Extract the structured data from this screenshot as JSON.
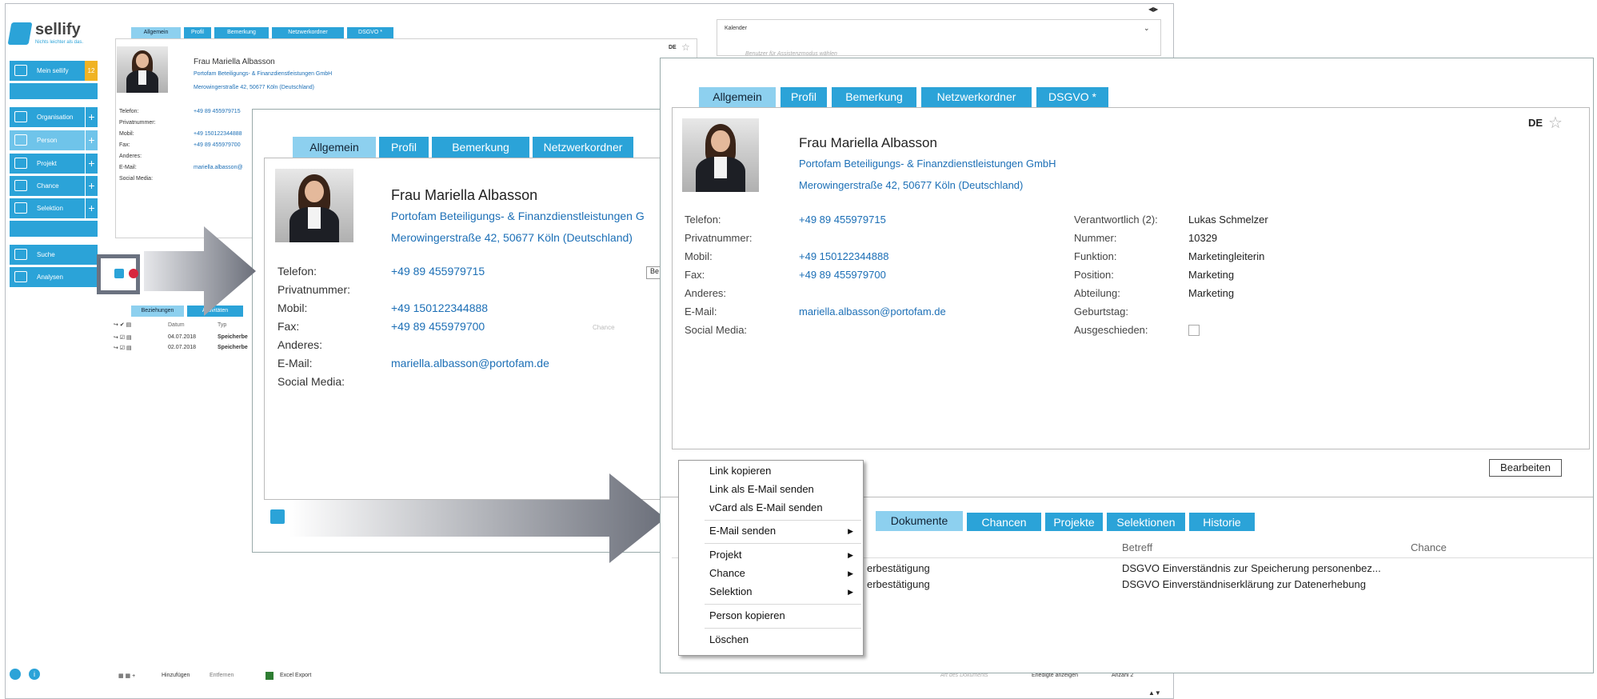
{
  "app": {
    "logo_name": "sellify",
    "logo_tagline": "Nichts leichter als das.",
    "window_controls": "◀▶"
  },
  "sidebar": {
    "items": [
      {
        "label": "Mein sellify",
        "badge": "12"
      },
      {
        "label": "Organisation"
      },
      {
        "label": "Person"
      },
      {
        "label": "Projekt"
      },
      {
        "label": "Chance"
      },
      {
        "label": "Selektion"
      },
      {
        "label": "Suche"
      },
      {
        "label": "Analysen"
      }
    ]
  },
  "base": {
    "tabs": [
      "Allgemein",
      "Profil",
      "Bemerkung",
      "Netzwerkordner",
      "DSGVO *"
    ],
    "lang": "DE",
    "name": "Frau Mariella Albasson",
    "company": "Portofam Beteiligungs- & Finanzdienstleistungen GmbH",
    "address": "Merowingerstraße 42, 50677 Köln (Deutschland)",
    "fields": [
      {
        "label": "Telefon:",
        "value": "+49 89 455979715"
      },
      {
        "label": "Privatnummer:",
        "value": ""
      },
      {
        "label": "Mobil:",
        "value": "+49 150122344888"
      },
      {
        "label": "Fax:",
        "value": "+49 89 455979700"
      },
      {
        "label": "Anderes:",
        "value": ""
      },
      {
        "label": "E-Mail:",
        "value": "mariella.albasson@"
      },
      {
        "label": "Social Media:",
        "value": ""
      }
    ],
    "calendar_title": "Kalender",
    "calendar_placeholder": "Benutzer für Assistenzmodus wählen",
    "lower_tabs": [
      "Beziehungen",
      "Aktivitäten"
    ],
    "table_headers": [
      "Datum",
      "Typ"
    ],
    "rows": [
      {
        "date": "04.07.2018",
        "type": "Speicherbe"
      },
      {
        "date": "02.07.2018",
        "type": "Speicherbe"
      }
    ],
    "footer": {
      "add": "Hinzufügen",
      "remove": "Entfernen",
      "export": "Excel Export",
      "doc_type": "Art des Dokuments",
      "show_done": "Erledigte anzeigen",
      "count": "Anzahl 2"
    }
  },
  "mid": {
    "tabs": [
      "Allgemein",
      "Profil",
      "Bemerkung",
      "Netzwerkordner"
    ],
    "name": "Frau Mariella Albasson",
    "company": "Portofam Beteiligungs- & Finanzdienstleistungen G",
    "address": "Merowingerstraße 42, 50677 Köln (Deutschland)",
    "fields": [
      {
        "label": "Telefon:",
        "value": "+49 89 455979715"
      },
      {
        "label": "Privatnummer:",
        "value": ""
      },
      {
        "label": "Mobil:",
        "value": "+49 150122344888"
      },
      {
        "label": "Fax:",
        "value": "+49 89 455979700"
      },
      {
        "label": "Anderes:",
        "value": ""
      },
      {
        "label": "E-Mail:",
        "value": "mariella.albasson@portofam.de"
      },
      {
        "label": "Social Media:",
        "value": ""
      }
    ],
    "side_button": "Be",
    "chance_label": "Chance"
  },
  "big": {
    "tabs": [
      "Allgemein",
      "Profil",
      "Bemerkung",
      "Netzwerkordner",
      "DSGVO *"
    ],
    "lang": "DE",
    "name": "Frau Mariella Albasson",
    "company": "Portofam Beteiligungs- & Finanzdienstleistungen GmbH",
    "address": "Merowingerstraße 42, 50677 Köln (Deutschland)",
    "fields": [
      {
        "label": "Telefon:",
        "value": "+49 89 455979715"
      },
      {
        "label": "Privatnummer:",
        "value": ""
      },
      {
        "label": "Mobil:",
        "value": "+49 150122344888"
      },
      {
        "label": "Fax:",
        "value": "+49 89 455979700"
      },
      {
        "label": "Anderes:",
        "value": ""
      },
      {
        "label": "E-Mail:",
        "value": "mariella.albasson@portofam.de"
      },
      {
        "label": "Social Media:",
        "value": ""
      }
    ],
    "right_fields": [
      {
        "label": "Verantwortlich (2):",
        "value": "Lukas Schmelzer"
      },
      {
        "label": "Nummer:",
        "value": "10329"
      },
      {
        "label": "Funktion:",
        "value": "Marketingleiterin"
      },
      {
        "label": "Position:",
        "value": "Marketing"
      },
      {
        "label": "Abteilung:",
        "value": "Marketing"
      },
      {
        "label": "Geburtstag:",
        "value": ""
      },
      {
        "label": "Ausgeschieden:",
        "value": ""
      }
    ],
    "edit_button": "Bearbeiten",
    "lower_tabs": [
      "Dokumente",
      "Chancen",
      "Projekte",
      "Selektionen",
      "Historie"
    ],
    "col_betreff": "Betreff",
    "col_chance": "Chance",
    "rows": [
      {
        "type": "erbestätigung",
        "subject": "DSGVO Einverständnis zur Speicherung personenbez..."
      },
      {
        "type": "erbestätigung",
        "subject": "DSGVO Einverständniserklärung zur Datenerhebung"
      }
    ]
  },
  "context_menu": {
    "items": [
      "Link kopieren",
      "Link als E-Mail senden",
      "vCard als E-Mail senden",
      "E-Mail senden",
      "Projekt",
      "Chance",
      "Selektion",
      "Person kopieren",
      "Löschen"
    ]
  },
  "colors": {
    "accent": "#2ba3d8",
    "accent_light": "#8dd0ef",
    "badge": "#f0b323",
    "link": "#1c6fb6"
  }
}
